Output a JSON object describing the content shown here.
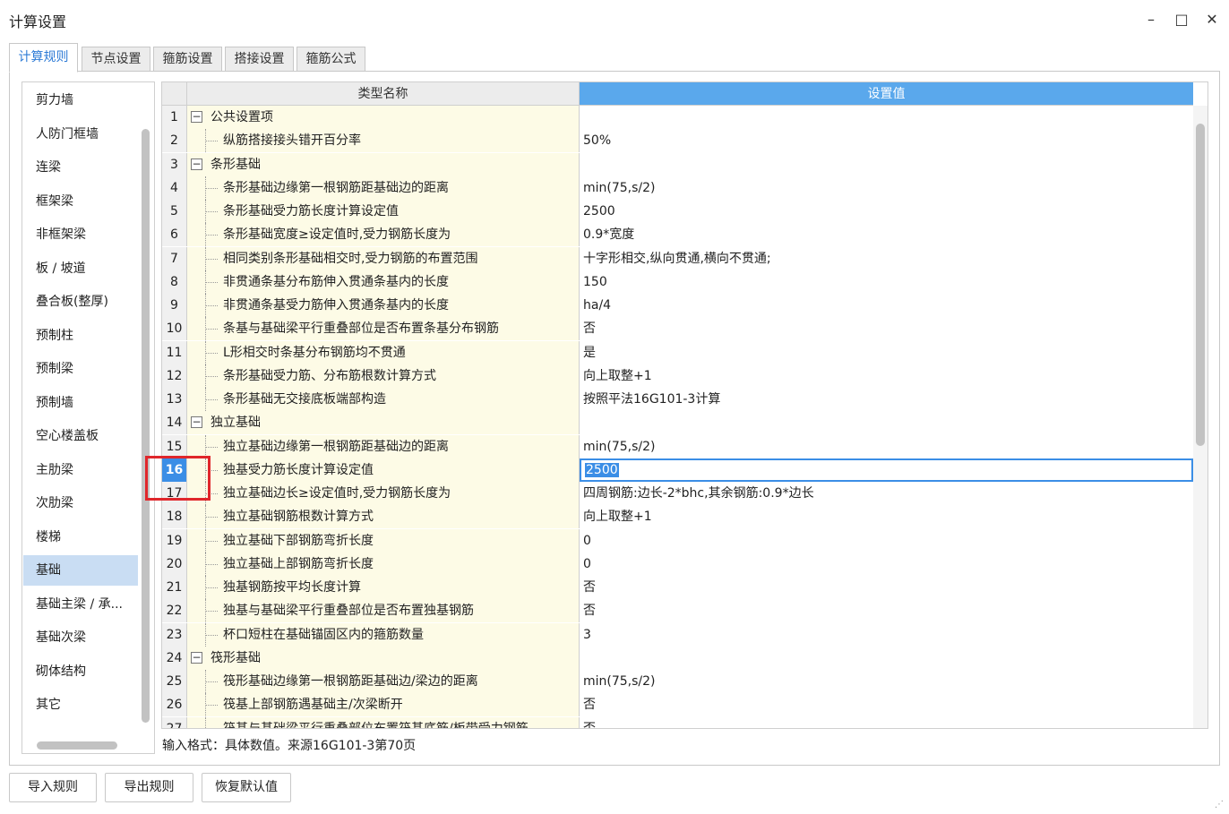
{
  "window": {
    "title": "计算设置"
  },
  "tabs": [
    "计算规则",
    "节点设置",
    "箍筋设置",
    "搭接设置",
    "箍筋公式"
  ],
  "sidebar": {
    "items": [
      "剪力墙",
      "人防门框墙",
      "连梁",
      "框架梁",
      "非框架梁",
      "板 / 坡道",
      "叠合板(整厚)",
      "预制柱",
      "预制梁",
      "预制墙",
      "空心楼盖板",
      "主肋梁",
      "次肋梁",
      "楼梯",
      "基础",
      "基础主梁 / 承...",
      "基础次梁",
      "砌体结构",
      "其它"
    ],
    "active": "基础"
  },
  "grid": {
    "headers": {
      "type": "类型名称",
      "value": "设置值"
    },
    "rows": [
      {
        "num": "1",
        "type": "公共设置项",
        "value": "",
        "group": true,
        "toggle": "−"
      },
      {
        "num": "2",
        "type": "纵筋搭接接头错开百分率",
        "value": "50%",
        "group": false
      },
      {
        "num": "3",
        "type": "条形基础",
        "value": "",
        "group": true,
        "toggle": "−"
      },
      {
        "num": "4",
        "type": "条形基础边缘第一根钢筋距基础边的距离",
        "value": "min(75,s/2)",
        "group": false
      },
      {
        "num": "5",
        "type": "条形基础受力筋长度计算设定值",
        "value": "2500",
        "group": false
      },
      {
        "num": "6",
        "type": "条形基础宽度≥设定值时,受力钢筋长度为",
        "value": "0.9*宽度",
        "group": false
      },
      {
        "num": "7",
        "type": "相同类别条形基础相交时,受力钢筋的布置范围",
        "value": "十字形相交,纵向贯通,横向不贯通;",
        "group": false
      },
      {
        "num": "8",
        "type": "非贯通条基分布筋伸入贯通条基内的长度",
        "value": "150",
        "group": false
      },
      {
        "num": "9",
        "type": "非贯通条基受力筋伸入贯通条基内的长度",
        "value": "ha/4",
        "group": false
      },
      {
        "num": "10",
        "type": "条基与基础梁平行重叠部位是否布置条基分布钢筋",
        "value": "否",
        "group": false
      },
      {
        "num": "11",
        "type": "L形相交时条基分布钢筋均不贯通",
        "value": "是",
        "group": false
      },
      {
        "num": "12",
        "type": "条形基础受力筋、分布筋根数计算方式",
        "value": "向上取整+1",
        "group": false
      },
      {
        "num": "13",
        "type": "条形基础无交接底板端部构造",
        "value": "按照平法16G101-3计算",
        "group": false
      },
      {
        "num": "14",
        "type": "独立基础",
        "value": "",
        "group": true,
        "toggle": "−"
      },
      {
        "num": "15",
        "type": "独立基础边缘第一根钢筋距基础边的距离",
        "value": "min(75,s/2)",
        "group": false
      },
      {
        "num": "16",
        "type": "独基受力筋长度计算设定值",
        "value": "2500",
        "group": false,
        "selected": true
      },
      {
        "num": "17",
        "type": "独立基础边长≥设定值时,受力钢筋长度为",
        "value": "四周钢筋:边长-2*bhc,其余钢筋:0.9*边长",
        "group": false
      },
      {
        "num": "18",
        "type": "独立基础钢筋根数计算方式",
        "value": "向上取整+1",
        "group": false
      },
      {
        "num": "19",
        "type": "独立基础下部钢筋弯折长度",
        "value": "0",
        "group": false
      },
      {
        "num": "20",
        "type": "独立基础上部钢筋弯折长度",
        "value": "0",
        "group": false
      },
      {
        "num": "21",
        "type": "独基钢筋按平均长度计算",
        "value": "否",
        "group": false
      },
      {
        "num": "22",
        "type": "独基与基础梁平行重叠部位是否布置独基钢筋",
        "value": "否",
        "group": false
      },
      {
        "num": "23",
        "type": "杯口短柱在基础锚固区内的箍筋数量",
        "value": "3",
        "group": false
      },
      {
        "num": "24",
        "type": "筏形基础",
        "value": "",
        "group": true,
        "toggle": "−"
      },
      {
        "num": "25",
        "type": "筏形基础边缘第一根钢筋距基础边/梁边的距离",
        "value": "min(75,s/2)",
        "group": false
      },
      {
        "num": "26",
        "type": "筏基上部钢筋遇基础主/次梁断开",
        "value": "否",
        "group": false
      },
      {
        "num": "27",
        "type": "筏基与基础梁平行重叠部位布置筏基底筋/板带受力钢筋",
        "value": "否",
        "group": false
      }
    ]
  },
  "hint": "输入格式：具体数值。来源16G101-3第70页",
  "buttons": {
    "import": "导入规则",
    "export": "导出规则",
    "restore": "恢复默认值"
  },
  "icons": {
    "minimize": "minimize-icon",
    "maximize": "maximize-icon",
    "close": "close-icon",
    "resize": "resize-grip-icon"
  },
  "colors": {
    "header_selected": "#5aa8ec",
    "type_cell_bg": "#fdfbe6",
    "selected_row": "#3b8ee6",
    "sidebar_active": "#c9ddf3",
    "annotation": "#e0262b",
    "tab_active_text": "#2e7bd6"
  }
}
